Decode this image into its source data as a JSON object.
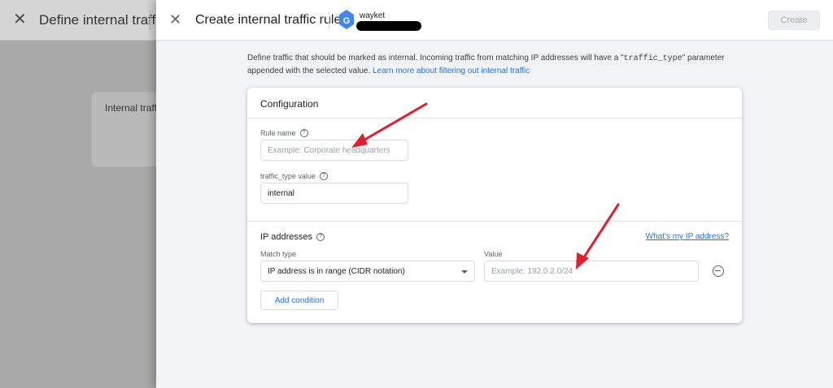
{
  "background": {
    "title": "Define internal traffic",
    "card_text": "Internal traffi"
  },
  "panel": {
    "title": "Create internal traffic rule",
    "account_name": "wayket",
    "create_label": "Create"
  },
  "description": {
    "prefix": "Define traffic that should be marked as internal. Incoming traffic from matching IP addresses will have a \"",
    "param": "traffic_type",
    "suffix": "\" parameter appended with the selected value. ",
    "link": "Learn more about filtering out internal traffic"
  },
  "configuration": {
    "title": "Configuration",
    "rule_name_label": "Rule name",
    "rule_name_placeholder": "Example: Corporate headquarters",
    "traffic_type_label": "traffic_type value",
    "traffic_type_value": "internal"
  },
  "ip_addresses": {
    "title": "IP addresses",
    "link": "What's my IP address?",
    "match_type_label": "Match type",
    "match_type_value": "IP address is in range (CIDR notation)",
    "value_label": "Value",
    "value_placeholder": "Example: 192.0.2.0/24",
    "add_condition_label": "Add condition"
  },
  "colors": {
    "accent": "#1a73e8",
    "annotation_arrow": "#e0202c"
  },
  "icons": {
    "close": "close-icon",
    "help": "help-circle-icon",
    "remove": "remove-circle-icon",
    "dropdown": "chevron-down-icon",
    "analytics": "google-analytics-icon"
  }
}
